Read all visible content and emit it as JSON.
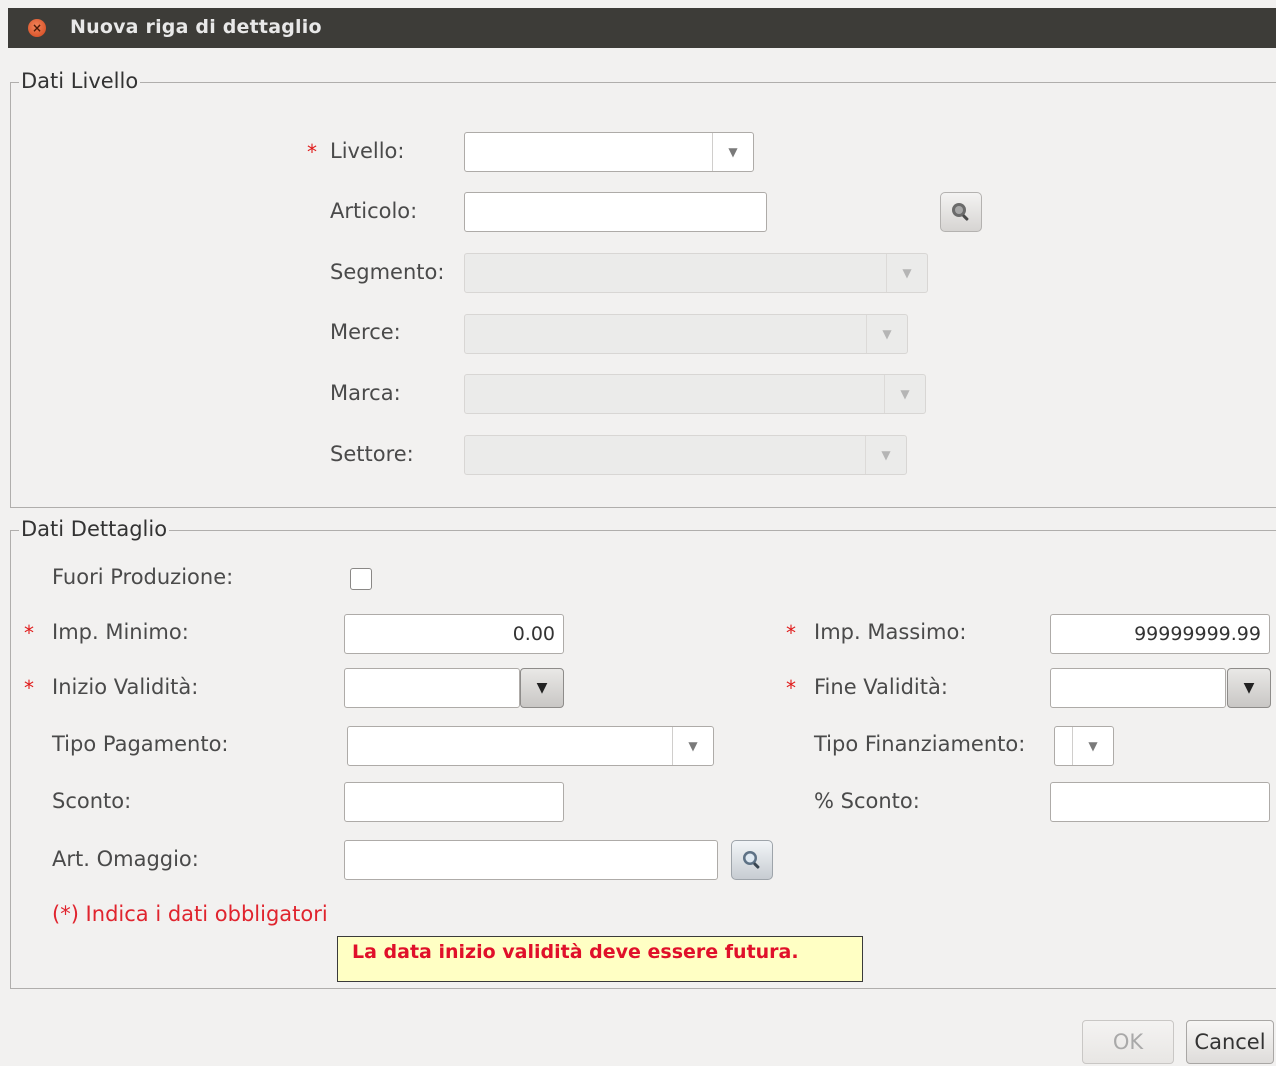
{
  "window": {
    "title": "Nuova riga di dettaglio"
  },
  "icons": {
    "close": "close-icon",
    "dropdown": "triangle-down-icon",
    "search": "magnifier-icon"
  },
  "dati_livello": {
    "title": "Dati Livello",
    "livello": {
      "label": "Livello:",
      "required_mark": "*",
      "value": ""
    },
    "articolo": {
      "label": "Articolo:",
      "value": ""
    },
    "segmento": {
      "label": "Segmento:",
      "value": ""
    },
    "merce": {
      "label": "Merce:",
      "value": ""
    },
    "marca": {
      "label": "Marca:",
      "value": ""
    },
    "settore": {
      "label": "Settore:",
      "value": ""
    }
  },
  "dati_dettaglio": {
    "title": "Dati Dettaglio",
    "fuori_produzione": {
      "label": "Fuori Produzione:",
      "checked": false
    },
    "imp_minimo": {
      "label": "Imp. Minimo:",
      "required_mark": "*",
      "value": "0.00"
    },
    "imp_massimo": {
      "label": "Imp. Massimo:",
      "required_mark": "*",
      "value": "99999999.99"
    },
    "inizio_validita": {
      "label": "Inizio Validità:",
      "required_mark": "*",
      "value": ""
    },
    "fine_validita": {
      "label": "Fine Validità:",
      "required_mark": "*",
      "value": ""
    },
    "tipo_pagamento": {
      "label": "Tipo Pagamento:",
      "value": ""
    },
    "tipo_finanziamento": {
      "label": "Tipo Finanziamento:",
      "value": ""
    },
    "sconto": {
      "label": "Sconto:",
      "value": ""
    },
    "perc_sconto": {
      "label": "% Sconto:",
      "value": ""
    },
    "art_omaggio": {
      "label": "Art. Omaggio:",
      "value": ""
    },
    "required_note": "(*) Indica i dati obbligatori",
    "error_message": "La data inizio validità deve essere futura."
  },
  "buttons": {
    "ok": "OK",
    "cancel": "Cancel",
    "ok_enabled": false
  },
  "colors": {
    "required": "#e01b1b",
    "error_text": "#e0102a",
    "error_bg": "#ffffc4",
    "titlebar": "#3d3c38"
  }
}
